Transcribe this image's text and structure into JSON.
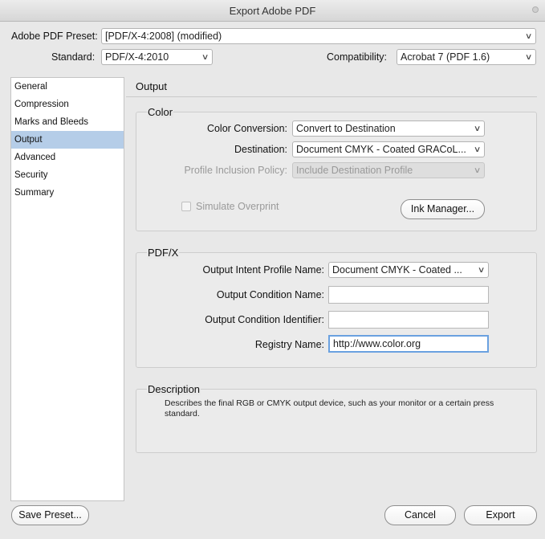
{
  "window": {
    "title": "Export Adobe PDF"
  },
  "preset": {
    "label": "Adobe PDF Preset:",
    "value": "[PDF/X-4:2008] (modified)"
  },
  "standard": {
    "label": "Standard:",
    "value": "PDF/X-4:2010"
  },
  "compatibility": {
    "label": "Compatibility:",
    "value": "Acrobat 7 (PDF 1.6)"
  },
  "sidebar": {
    "items": [
      {
        "label": "General"
      },
      {
        "label": "Compression"
      },
      {
        "label": "Marks and Bleeds"
      },
      {
        "label": "Output"
      },
      {
        "label": "Advanced"
      },
      {
        "label": "Security"
      },
      {
        "label": "Summary"
      }
    ],
    "selected": "Output"
  },
  "panel": {
    "title": "Output"
  },
  "color": {
    "title": "Color",
    "conversion_label": "Color Conversion:",
    "conversion_value": "Convert to Destination",
    "destination_label": "Destination:",
    "destination_value": "Document CMYK - Coated GRACoL...",
    "policy_label": "Profile Inclusion Policy:",
    "policy_value": "Include Destination Profile",
    "simulate_overprint_label": "Simulate Overprint",
    "simulate_overprint_checked": false,
    "ink_manager_label": "Ink Manager..."
  },
  "pdfx": {
    "title": "PDF/X",
    "intent_label": "Output Intent Profile Name:",
    "intent_value": "Document CMYK - Coated ...",
    "condition_name_label": "Output Condition Name:",
    "condition_name_value": "",
    "condition_id_label": "Output Condition Identifier:",
    "condition_id_value": "",
    "registry_label": "Registry Name:",
    "registry_value": "http://www.color.org"
  },
  "description": {
    "title": "Description",
    "line1": "Describes the final RGB or CMYK output device, such as your monitor or a certain press",
    "line2": "standard."
  },
  "footer": {
    "save_preset_label": "Save Preset...",
    "cancel_label": "Cancel",
    "export_label": "Export"
  },
  "colors": {
    "selection": "#b5cde8",
    "focus_ring": "#6aa1e0"
  }
}
